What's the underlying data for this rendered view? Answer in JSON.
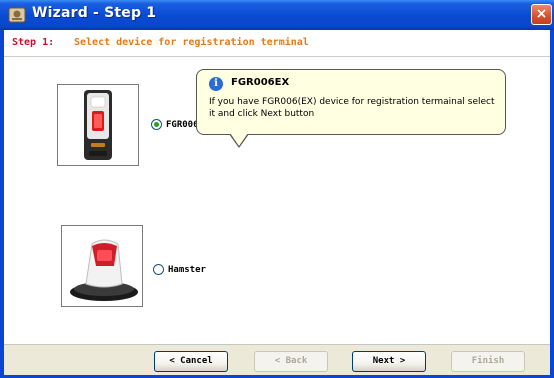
{
  "window": {
    "title": "Wizard - Step 1",
    "close_label": "×"
  },
  "step": {
    "label": "Step 1:",
    "description": "Select device for registration terminal"
  },
  "devices": [
    {
      "label": "FGR006EX",
      "checked": true
    },
    {
      "label": "Hamster",
      "checked": false
    }
  ],
  "tooltip": {
    "icon": "i",
    "title": "FGR006EX",
    "body": "If you have FGR006(EX) device for registration termainal select it and click Next button"
  },
  "buttons": {
    "cancel": "< Cancel",
    "back": "< Back",
    "next": "Next >",
    "finish": "Finish"
  },
  "colors": {
    "titlebar": "#0a46cc",
    "step_label": "#c8102e",
    "step_desc": "#e07b1a",
    "tooltip_bg": "#ffffe1",
    "radio_dot": "#21a121"
  }
}
